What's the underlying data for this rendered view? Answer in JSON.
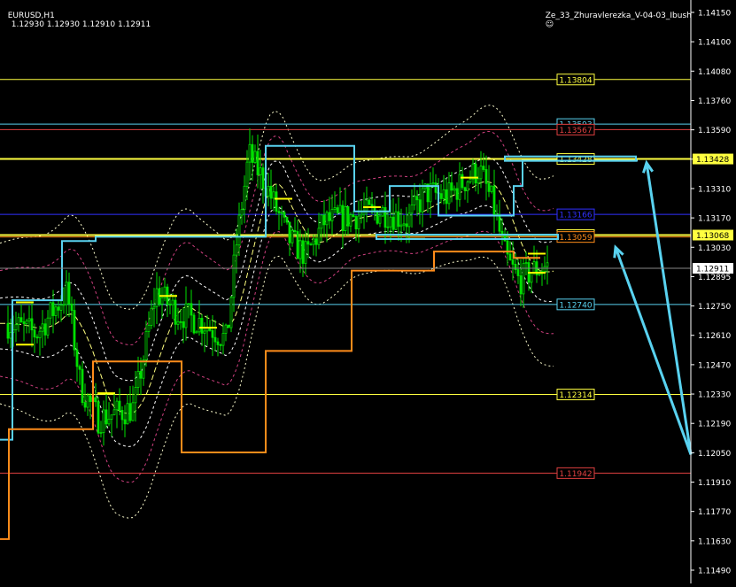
{
  "header": {
    "symbol": "EURUSD,H1",
    "ohlc": "1.12930 1.12930 1.12910 1.12911",
    "indicator": "Ze_33_Zhuravlerezka_V-04-03_Ibush"
  },
  "colors": {
    "background": "#000000",
    "candle": "#00e000",
    "axis": "#ffffff",
    "cyan": "#59d2f0",
    "orange": "#ff8c1a",
    "yellow_level": "#ffff40",
    "red_level": "#e04040",
    "blue_level": "#3030ff",
    "ma_dashed": "#ffffd0",
    "env_pink": "#d04080"
  },
  "chart_data": {
    "type": "line",
    "symbol": "EURUSD",
    "timeframe": "H1",
    "ylim": [
      1.1142,
      1.1418
    ],
    "y_ticks": [
      "1.14150",
      "1.14100",
      "1.14080",
      "1.13760",
      "1.13590",
      "1.13430",
      "1.13310",
      "1.13170",
      "1.13030",
      "1.12895",
      "1.12750",
      "1.12610",
      "1.12470",
      "1.12330",
      "1.12190",
      "1.12050",
      "1.11910",
      "1.11770",
      "1.11630",
      "1.11490"
    ],
    "current_price": "1.12911",
    "current_price_value": 1.12911,
    "levels": [
      {
        "label": "1.13804",
        "value": 1.13804,
        "color": "#ffff40"
      },
      {
        "label": "1.13593",
        "value": 1.13593,
        "color": "#59d2f0"
      },
      {
        "label": "1.13567",
        "value": 1.13567,
        "color": "#e04040"
      },
      {
        "label": "1.13428",
        "value": 1.13428,
        "color": "#ffff40",
        "axis_tag": true
      },
      {
        "label": "1.13166",
        "value": 1.13166,
        "color": "#3030ff"
      },
      {
        "label": "1.13068",
        "value": 1.13068,
        "color": "#ffff40",
        "axis_tag": true
      },
      {
        "label": "1.13059",
        "value": 1.13059,
        "color": "#ff8c1a"
      },
      {
        "label": "1.12740",
        "value": 1.1274,
        "color": "#59d2f0"
      },
      {
        "label": "1.12314",
        "value": 1.12314,
        "color": "#ffff40"
      },
      {
        "label": "1.11942",
        "value": 1.11942,
        "color": "#e04040"
      }
    ],
    "upper_step": [
      [
        0,
        1.121
      ],
      [
        14,
        1.121
      ],
      [
        14,
        1.1276
      ],
      [
        70,
        1.1276
      ],
      [
        70,
        1.1304
      ],
      [
        108,
        1.1304
      ],
      [
        108,
        1.1306
      ],
      [
        300,
        1.1306
      ],
      [
        300,
        1.1349
      ],
      [
        400,
        1.1349
      ],
      [
        400,
        1.1318
      ],
      [
        440,
        1.1318
      ],
      [
        440,
        1.133
      ],
      [
        495,
        1.133
      ],
      [
        495,
        1.1316
      ],
      [
        580,
        1.1316
      ],
      [
        580,
        1.133
      ],
      [
        590,
        1.133
      ],
      [
        590,
        1.1342
      ],
      [
        720,
        1.1342
      ]
    ],
    "lower_step": [
      [
        0,
        1.1163
      ],
      [
        10,
        1.1163
      ],
      [
        10,
        1.1215
      ],
      [
        105,
        1.1215
      ],
      [
        105,
        1.1247
      ],
      [
        205,
        1.1247
      ],
      [
        205,
        1.1204
      ],
      [
        300,
        1.1204
      ],
      [
        300,
        1.1252
      ],
      [
        397,
        1.1252
      ],
      [
        397,
        1.129
      ],
      [
        490,
        1.129
      ],
      [
        490,
        1.1299
      ],
      [
        580,
        1.1299
      ],
      [
        580,
        1.1296
      ],
      [
        610,
        1.1296
      ]
    ],
    "price_path": [
      [
        10,
        1.1265
      ],
      [
        40,
        1.126
      ],
      [
        75,
        1.128
      ],
      [
        90,
        1.1235
      ],
      [
        110,
        1.122
      ],
      [
        150,
        1.1225
      ],
      [
        175,
        1.128
      ],
      [
        200,
        1.127
      ],
      [
        230,
        1.1265
      ],
      [
        255,
        1.1257
      ],
      [
        265,
        1.13
      ],
      [
        280,
        1.1345
      ],
      [
        300,
        1.133
      ],
      [
        325,
        1.1305
      ],
      [
        345,
        1.1297
      ],
      [
        365,
        1.1313
      ],
      [
        400,
        1.1316
      ],
      [
        430,
        1.1318
      ],
      [
        460,
        1.1314
      ],
      [
        480,
        1.1327
      ],
      [
        505,
        1.1325
      ],
      [
        525,
        1.1333
      ],
      [
        540,
        1.1338
      ],
      [
        555,
        1.1322
      ],
      [
        570,
        1.1296
      ],
      [
        585,
        1.1285
      ],
      [
        600,
        1.129
      ],
      [
        615,
        1.1292
      ]
    ],
    "arrows": [
      {
        "from": [
          780,
          1.1203
        ],
        "to": [
          730,
          1.1341
        ]
      },
      {
        "from": [
          780,
          1.1203
        ],
        "to": [
          695,
          1.1301
        ]
      }
    ]
  }
}
